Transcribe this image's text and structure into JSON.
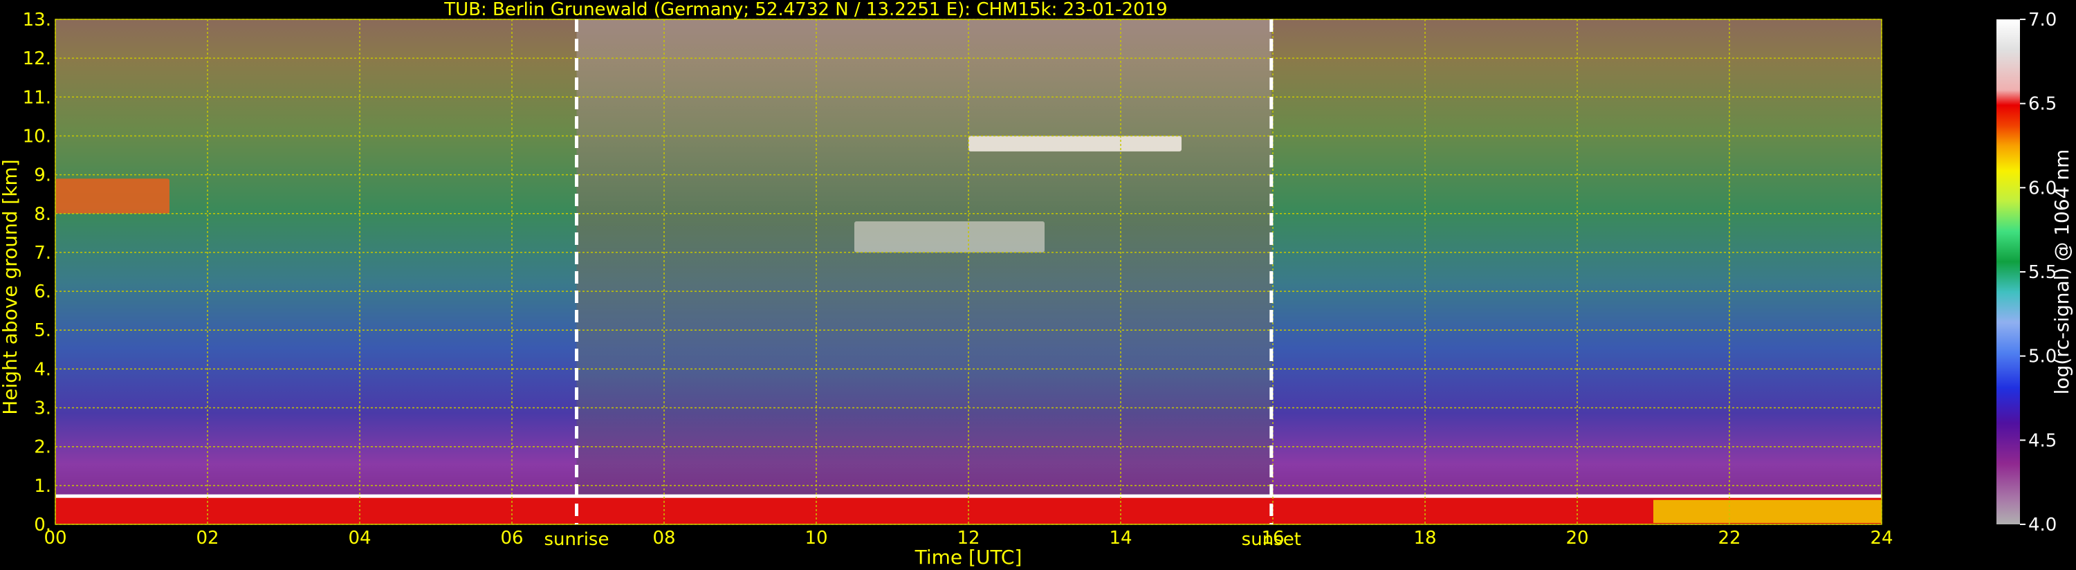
{
  "chart_data": {
    "type": "heatmap",
    "title": "TUB: Berlin Grunewald (Germany; 52.4732 N / 13.2251 E):    CHM15k: 23-01-2019",
    "xlabel": "Time [UTC]",
    "ylabel": "Height above ground [km]",
    "xlim": [
      0,
      24
    ],
    "ylim": [
      0,
      13
    ],
    "x_ticks": [
      "00",
      "02",
      "04",
      "06",
      "08",
      "10",
      "12",
      "14",
      "16",
      "18",
      "20",
      "22",
      "24"
    ],
    "y_ticks": [
      "0.",
      "1.",
      "2.",
      "3.",
      "4.",
      "5.",
      "6.",
      "7.",
      "8.",
      "9.",
      "10.",
      "11.",
      "12.",
      "13."
    ],
    "grid": true,
    "events": [
      {
        "label": "sunrise",
        "x": 6.85
      },
      {
        "label": "sunset",
        "x": 15.98
      }
    ],
    "colorbar": {
      "label": "log(rc-signal) @ 1064 nm",
      "range": [
        4.0,
        7.0
      ],
      "ticks": [
        "4.0",
        "4.5",
        "5.0",
        "5.5",
        "6.0",
        "6.5",
        "7.0"
      ]
    },
    "features": [
      {
        "name": "boundary layer",
        "x_range": [
          0,
          24
        ],
        "height_km": [
          0.0,
          0.7
        ]
      },
      {
        "name": "cloud layer",
        "x_range": [
          12.0,
          14.8
        ],
        "height_km": [
          9.6,
          10.0
        ]
      },
      {
        "name": "cloud layer",
        "x_range": [
          10.5,
          13.0
        ],
        "height_km": [
          7.0,
          7.8
        ]
      },
      {
        "name": "cloud layer",
        "x_range": [
          0.0,
          1.5
        ],
        "height_km": [
          8.0,
          8.9
        ]
      }
    ],
    "colors": {
      "axis": "#ffff00",
      "grid": "#c8c800",
      "event_line": "#ffffff",
      "background": "#000000"
    }
  }
}
